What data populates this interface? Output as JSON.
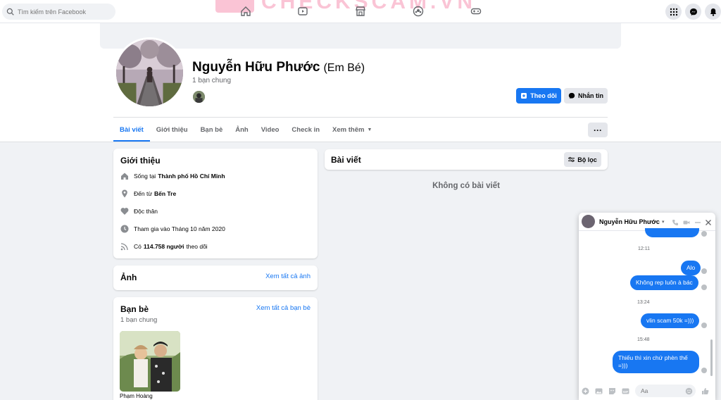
{
  "topbar": {
    "search_placeholder": "Tìm kiếm trên Facebook",
    "nav_icons": [
      "home-icon",
      "watch-icon",
      "marketplace-icon",
      "groups-icon",
      "gaming-icon"
    ],
    "right_icons": [
      "menu-grid-icon",
      "messenger-icon",
      "notifications-icon"
    ],
    "watermark": "CHECKSCAM.VN"
  },
  "profile": {
    "name": "Nguyễn Hữu Phước",
    "nickname": "(Em Bé)",
    "mutual_friends": "1 bạn chung",
    "follow_label": "Theo dõi",
    "message_label": "Nhắn tin",
    "more_label": "···"
  },
  "tabs": [
    {
      "label": "Bài viết",
      "active": true
    },
    {
      "label": "Giới thiệu",
      "active": false
    },
    {
      "label": "Bạn bè",
      "active": false
    },
    {
      "label": "Ảnh",
      "active": false
    },
    {
      "label": "Video",
      "active": false
    },
    {
      "label": "Check in",
      "active": false
    },
    {
      "label": "Xem thêm",
      "active": false
    }
  ],
  "intro": {
    "title": "Giới thiệu",
    "lives_prefix": "Sống tại",
    "lives_value": "Thành phố Hồ Chí Minh",
    "from_prefix": "Đến từ",
    "from_value": "Bến Tre",
    "relationship": "Độc thân",
    "joined": "Tham gia vào Tháng 10 năm 2020",
    "followers_prefix": "Có",
    "followers_value": "114.758 người",
    "followers_suffix": "theo dõi"
  },
  "photos": {
    "title": "Ảnh",
    "see_all": "Xem tất cả ảnh"
  },
  "friends": {
    "title": "Bạn bè",
    "see_all": "Xem tất cả bạn bè",
    "subtitle": "1 bạn chung",
    "friend_name": "Phạm Hoàng"
  },
  "posts": {
    "title": "Bài viết",
    "filter_label": "Bộ lọc",
    "empty_text": "Không có bài viết"
  },
  "chat": {
    "name": "Nguyễn Hữu Phước",
    "times": [
      "12:11",
      "13:24",
      "15:48"
    ],
    "messages": [
      "Alo",
      "Không rep luôn à bác",
      "vlin scam 50k =)))",
      "Thiếu thì xin chứ phèn thế",
      "=)))"
    ],
    "input_placeholder": "Aa"
  }
}
